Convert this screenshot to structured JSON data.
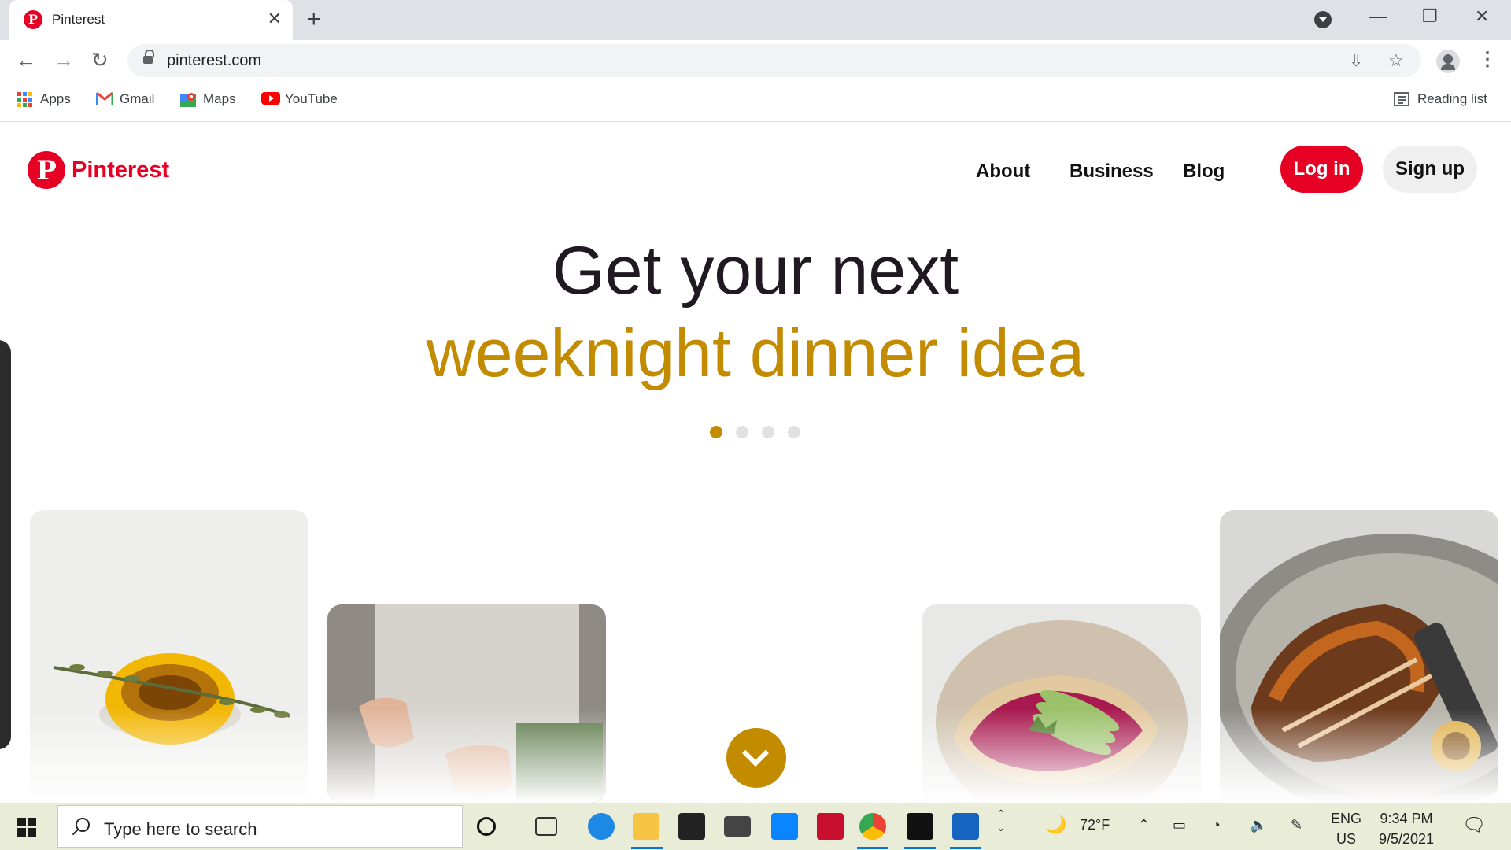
{
  "browser": {
    "tab_title": "Pinterest",
    "tab_favicon": "P",
    "url": "pinterest.com",
    "bookmarks": [
      {
        "label": "Apps",
        "icon": "apps-grid-icon"
      },
      {
        "label": "Gmail",
        "icon": "gmail-icon"
      },
      {
        "label": "Maps",
        "icon": "maps-icon"
      },
      {
        "label": "YouTube",
        "icon": "youtube-icon"
      }
    ],
    "reading_list": "Reading list"
  },
  "site": {
    "logo_text": "Pinterest",
    "logo_letter": "P",
    "brand_color": "#e60023",
    "nav": {
      "about": "About",
      "business": "Business",
      "blog": "Blog"
    },
    "login": "Log in",
    "signup": "Sign up"
  },
  "hero": {
    "line1": "Get your next",
    "line2": "weeknight dinner idea",
    "accent_color": "#c28b00",
    "carousel_active_index": 0,
    "carousel_count": 4
  },
  "taskbar": {
    "search_placeholder": "Type here to search",
    "weather": "72°F",
    "lang_top": "ENG",
    "lang_bottom": "US",
    "time": "9:34 PM",
    "date": "9/5/2021"
  }
}
